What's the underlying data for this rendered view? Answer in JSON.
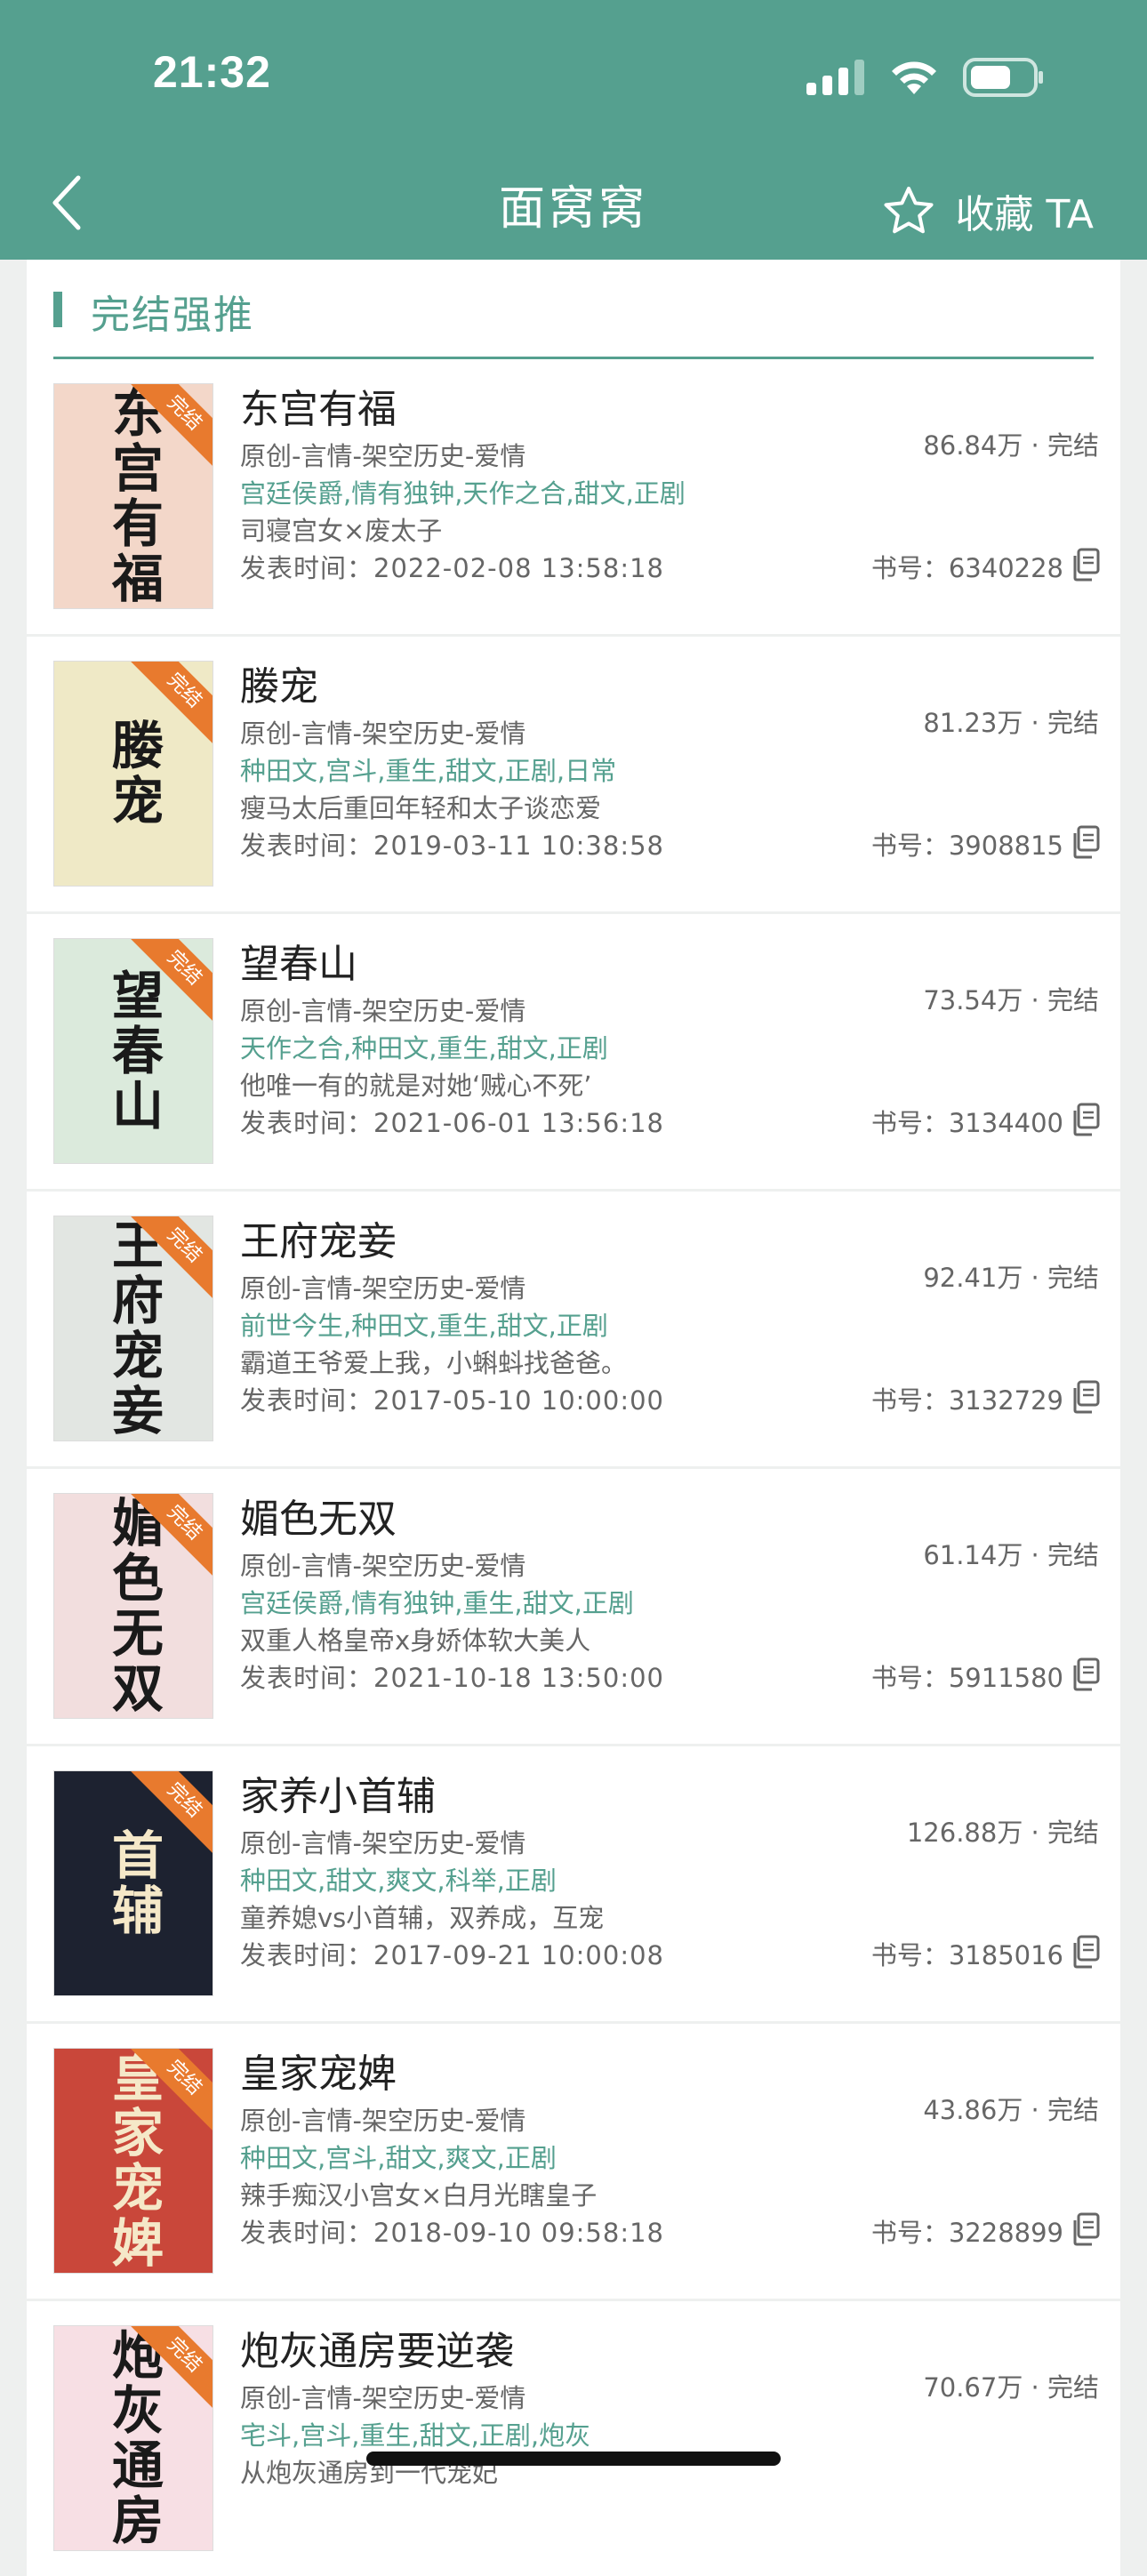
{
  "status": {
    "time": "21:32"
  },
  "nav": {
    "title": "面窝窝",
    "favorite_label": "收藏 TA"
  },
  "section": {
    "title": "完结强推"
  },
  "books": [
    {
      "title": "东宫有福",
      "category": "原创-言情-架空历史-爱情",
      "tags": "宫廷侯爵,情有独钟,天作之合,甜文,正剧",
      "desc": "司寝宫女×废太子",
      "date": "发表时间：2022-02-08 13:58:18",
      "stat": "86.84万 · 完结",
      "id": "书号：6340228",
      "cover_text": "东宫有福",
      "cover_color": "#f3d7c9"
    },
    {
      "title": "媵宠",
      "category": "原创-言情-架空历史-爱情",
      "tags": "种田文,宫斗,重生,甜文,正剧,日常",
      "desc": "瘦马太后重回年轻和太子谈恋爱",
      "date": "发表时间：2019-03-11 10:38:58",
      "stat": "81.23万 · 完结",
      "id": "书号：3908815",
      "cover_text": "媵宠",
      "cover_color": "#efe9c6"
    },
    {
      "title": "望春山",
      "category": "原创-言情-架空历史-爱情",
      "tags": "天作之合,种田文,重生,甜文,正剧",
      "desc": "他唯一有的就是对她‘贼心不死’",
      "date": "发表时间：2021-06-01 13:56:18",
      "stat": "73.54万 · 完结",
      "id": "书号：3134400",
      "cover_text": "望春山",
      "cover_color": "#dbeadc"
    },
    {
      "title": "王府宠妾",
      "category": "原创-言情-架空历史-爱情",
      "tags": "前世今生,种田文,重生,甜文,正剧",
      "desc": "霸道王爷爱上我，小蝌蚪找爸爸。",
      "date": "发表时间：2017-05-10 10:00:00",
      "stat": "92.41万 · 完结",
      "id": "书号：3132729",
      "cover_text": "王府宠妾",
      "cover_color": "#e2e6e2"
    },
    {
      "title": "媚色无双",
      "category": "原创-言情-架空历史-爱情",
      "tags": "宫廷侯爵,情有独钟,重生,甜文,正剧",
      "desc": "双重人格皇帝x身娇体软大美人",
      "date": "发表时间：2021-10-18 13:50:00",
      "stat": "61.14万 · 完结",
      "id": "书号：5911580",
      "cover_text": "媚色无双",
      "cover_color": "#f2dede"
    },
    {
      "title": "家养小首辅",
      "category": "原创-言情-架空历史-爱情",
      "tags": "种田文,甜文,爽文,科举,正剧",
      "desc": "童养媳vs小首辅，双养成，互宠",
      "date": "发表时间：2017-09-21 10:00:08",
      "stat": "126.88万 · 完结",
      "id": "书号：3185016",
      "cover_text": "首辅",
      "cover_color": "#1d2230"
    },
    {
      "title": "皇家宠婢",
      "category": "原创-言情-架空历史-爱情",
      "tags": "种田文,宫斗,甜文,爽文,正剧",
      "desc": "辣手痴汉小宫女×白月光瞎皇子",
      "date": "发表时间：2018-09-10 09:58:18",
      "stat": "43.86万 · 完结",
      "id": "书号：3228899",
      "cover_text": "皇家宠婢",
      "cover_color": "#c9473a"
    },
    {
      "title": "炮灰通房要逆袭",
      "category": "原创-言情-架空历史-爱情",
      "tags": "宅斗,宫斗,重生,甜文,正剧,炮灰",
      "desc": "从炮灰通房到一代宠妃",
      "date": "",
      "stat": "70.67万 · 完结",
      "id": "",
      "cover_text": "炮灰通房",
      "cover_color": "#f7dfe4"
    }
  ],
  "badge": "完结"
}
